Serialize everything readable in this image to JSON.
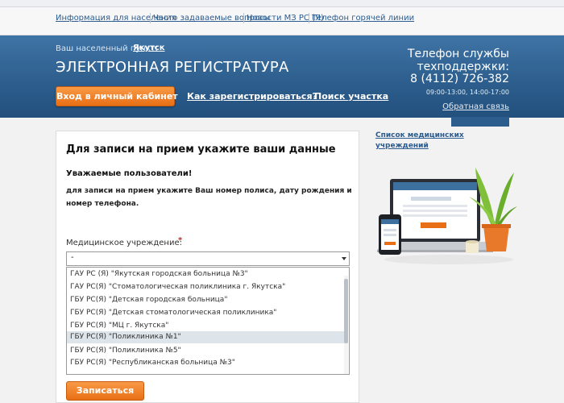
{
  "top_nav": {
    "links": [
      "Информация для населения",
      "Часто задаваемые вопросы",
      "Новости МЗ РС (Я)",
      "Телефон горячей линии"
    ]
  },
  "header": {
    "city_label": "Ваш населенный пункт:",
    "city_name": "Якутск",
    "title": "ЭЛЕКТРОННАЯ РЕГИСТРАТУРА",
    "login_button": "Вход в личный кабинет",
    "register_link": "Как зарегистрироваться?",
    "find_district_link": "Поиск участка",
    "support": {
      "title_line1": "Телефон службы",
      "title_line2": "техподдержки:",
      "phone": "8 (4112) 726-382",
      "hours": "09:00-13:00, 14:00-17:00",
      "feedback": "Обратная связь"
    }
  },
  "form": {
    "title": "Для записи на прием укажите ваши данные",
    "notice_title": "Уважаемые пользователи!",
    "notice_text": "для записи на прием укажите Ваш номер полиса, дату рождения и номер телефона.",
    "field_label": "Медицинское учреждение:",
    "required_mark": "*",
    "select_value": "-",
    "options": [
      "ГАУ РС (Я) \"Якутская городская больница №3\"",
      "ГАУ РС(Я) \"Стоматологическая поликлиника г. Якутска\"",
      "ГБУ РС(Я) \"Детская городская больница\"",
      "ГБУ РС(Я) \"Детская стоматологическая поликлиника\"",
      "ГБУ РС(Я) \"МЦ г. Якутска\"",
      "ГБУ РС(Я) \"Поликлиника №1\"",
      "ГБУ РС(Я) \"Поликлиника №5\"",
      "ГБУ РС(Я) \"Республиканская больница №3\""
    ],
    "highlighted_option_index": 5,
    "submit_button": "Записаться"
  },
  "sidebar": {
    "link": "Список медицинских учреждений"
  },
  "colors": {
    "header_blue": "#2c5d8c",
    "accent_orange": "#e86f15",
    "link_blue": "#2c5c8f"
  }
}
